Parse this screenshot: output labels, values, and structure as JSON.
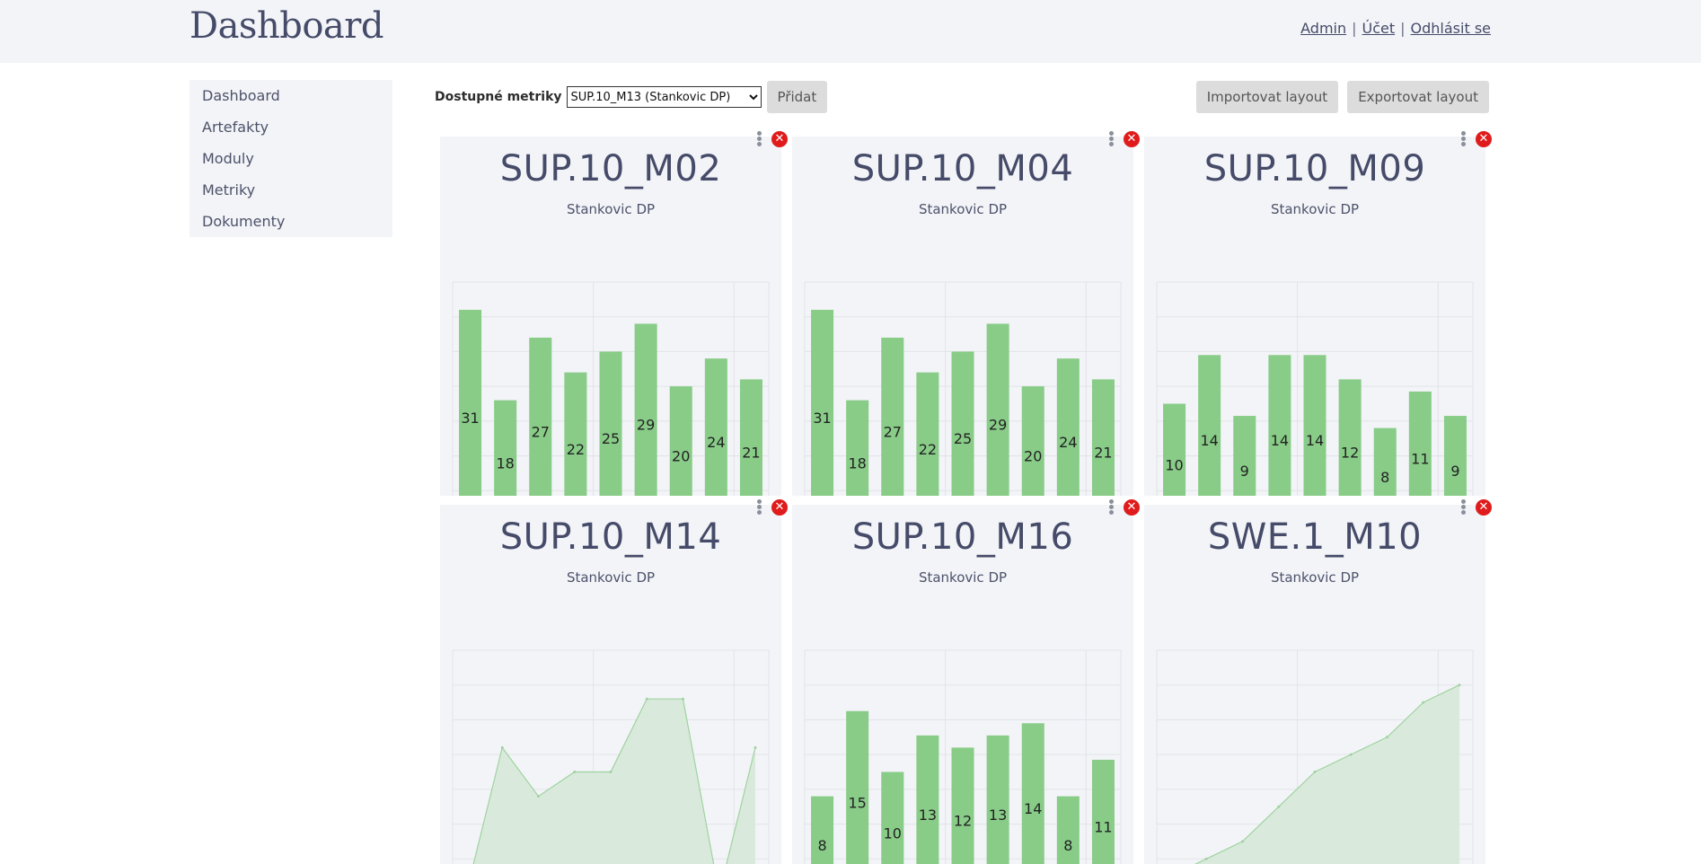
{
  "header": {
    "title": "Dashboard",
    "links": [
      "Admin",
      "Účet",
      "Odhlásit se"
    ]
  },
  "sidebar": {
    "items": [
      {
        "label": "Dashboard"
      },
      {
        "label": "Artefakty"
      },
      {
        "label": "Moduly"
      },
      {
        "label": "Metriky"
      },
      {
        "label": "Dokumenty"
      }
    ]
  },
  "toolbar": {
    "metrics_label": "Dostupné metriky",
    "selected_metric": "SUP.10_M13 (Stankovic DP)",
    "add_label": "Přidat",
    "import_label": "Importovat layout",
    "export_label": "Exportovat layout"
  },
  "colors": {
    "bar_fill": "#88cc88",
    "area_fill": "#d9eadc",
    "area_line": "#9fd39f",
    "close_red": "#e01b1b"
  },
  "chart_data": [
    {
      "type": "bar",
      "title": "SUP.10_M02",
      "subtitle": "Stankovic DP",
      "values": [
        31,
        18,
        27,
        22,
        25,
        29,
        20,
        24,
        21
      ],
      "ylim": [
        0,
        35
      ]
    },
    {
      "type": "bar",
      "title": "SUP.10_M04",
      "subtitle": "Stankovic DP",
      "values": [
        31,
        18,
        27,
        22,
        25,
        29,
        20,
        24,
        21
      ],
      "ylim": [
        0,
        35
      ]
    },
    {
      "type": "bar",
      "title": "SUP.10_M09",
      "subtitle": "Stankovic DP",
      "values": [
        10,
        14,
        9,
        14,
        14,
        12,
        8,
        11,
        9
      ],
      "ylim": [
        0,
        20
      ]
    },
    {
      "type": "area",
      "title": "SUP.10_M14",
      "subtitle": "Stankovic DP",
      "values": [
        0,
        6,
        4,
        5,
        5,
        8,
        8,
        0,
        6
      ],
      "ylim": [
        0,
        10
      ]
    },
    {
      "type": "bar",
      "title": "SUP.10_M16",
      "subtitle": "Stankovic DP",
      "values": [
        8,
        15,
        10,
        13,
        12,
        13,
        14,
        8,
        11
      ],
      "ylim": [
        0,
        20
      ]
    },
    {
      "type": "area",
      "title": "SWE.1_M10",
      "subtitle": "Stankovic DP",
      "values": [
        1,
        2,
        3,
        5,
        7,
        8,
        9,
        11,
        12
      ],
      "ylim": [
        0,
        14
      ]
    }
  ]
}
